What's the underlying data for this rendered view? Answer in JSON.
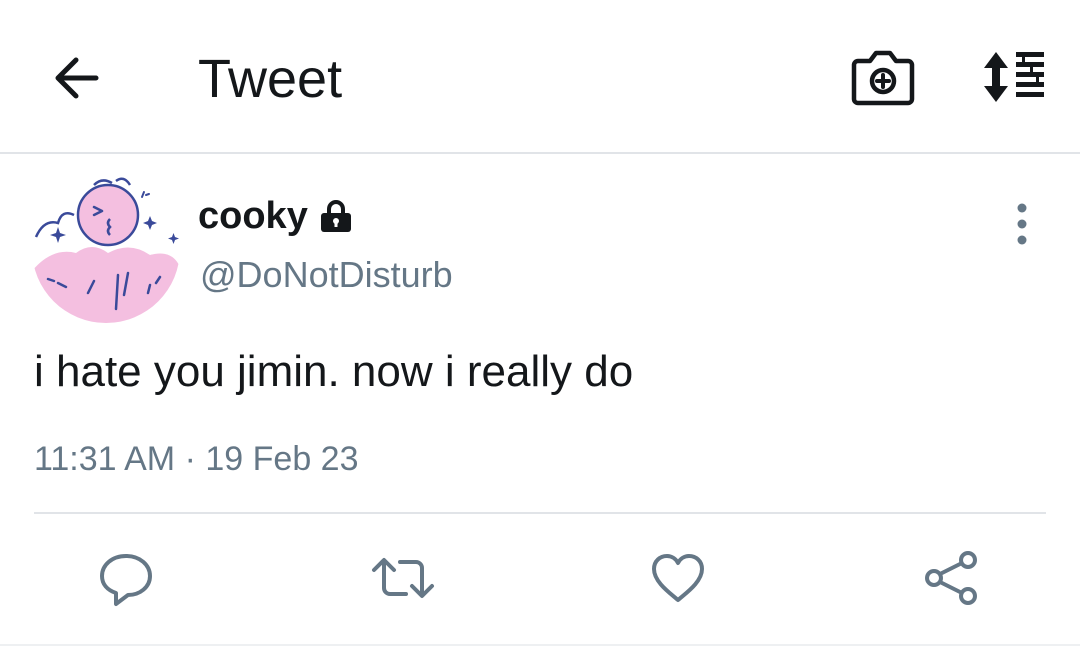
{
  "header": {
    "title": "Tweet",
    "back_icon": "arrow-left-icon",
    "camera_icon": "camera-plus-icon",
    "sort_icon": "sort-list-icon"
  },
  "tweet": {
    "display_name": "cooky",
    "protected_icon": "lock-icon",
    "handle": "@DoNotDisturb",
    "text": "i hate you jimin. now i really do",
    "time": "11:31 AM",
    "separator": "·",
    "date": "19 Feb 23",
    "more_icon": "more-vertical-icon"
  },
  "actions": [
    {
      "name": "reply",
      "icon": "comment-icon"
    },
    {
      "name": "retweet",
      "icon": "retweet-icon"
    },
    {
      "name": "like",
      "icon": "heart-icon"
    },
    {
      "name": "share",
      "icon": "share-icon"
    }
  ],
  "colors": {
    "text_primary": "#14171a",
    "text_secondary": "#657786",
    "icon_gray": "#657786",
    "divider": "#e1e4e8",
    "avatar_pink": "#f4bfe0",
    "avatar_blue": "#3a4a9a"
  }
}
